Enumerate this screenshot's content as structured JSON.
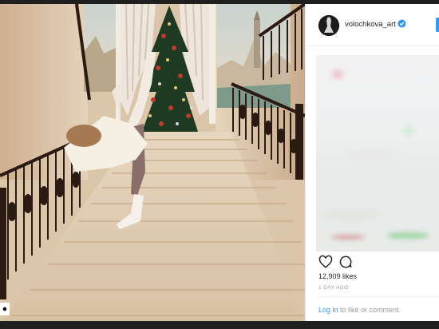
{
  "post": {
    "username": "volochkova_art",
    "likes_text": "12,909 likes",
    "time_text": "1 DAY AGO",
    "login_link": "Log in",
    "login_suffix": " to like or comment."
  },
  "icons": {
    "corner": "person-tag-icon",
    "like": "heart-icon",
    "comment": "comment-icon",
    "verified": "verified-badge-icon"
  },
  "colors": {
    "link": "#3897f0",
    "verified": "#3897f0",
    "muted": "#999999",
    "text": "#262626"
  }
}
